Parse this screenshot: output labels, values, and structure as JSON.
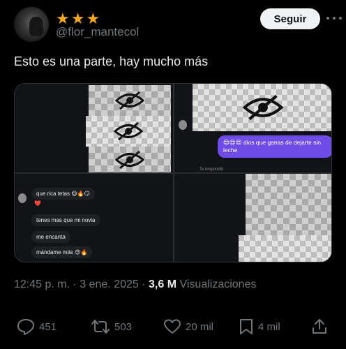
{
  "author": {
    "display_name": "★★★",
    "handle": "@flor_mantecol",
    "follow_label": "Seguir"
  },
  "tweet": {
    "text": "Esto es una parte, hay mucho más"
  },
  "chat": {
    "incoming": [
      "que rica tetas 😋🔥😏",
      "❤️",
      "tenes mas que mi novia",
      "me encanta",
      "mándame más 😍🔥"
    ],
    "outgoing": "😍😍😍 dios que ganas de dejarte sin leche",
    "replied_label": "Te respondió"
  },
  "meta": {
    "time": "12:45 p. m.",
    "date": "3 ene. 2025",
    "views_count": "3,6 M",
    "views_label": "Visualizaciones"
  },
  "actions": {
    "replies": "451",
    "reposts": "503",
    "likes": "20 mil",
    "bookmarks": "4 mil"
  }
}
